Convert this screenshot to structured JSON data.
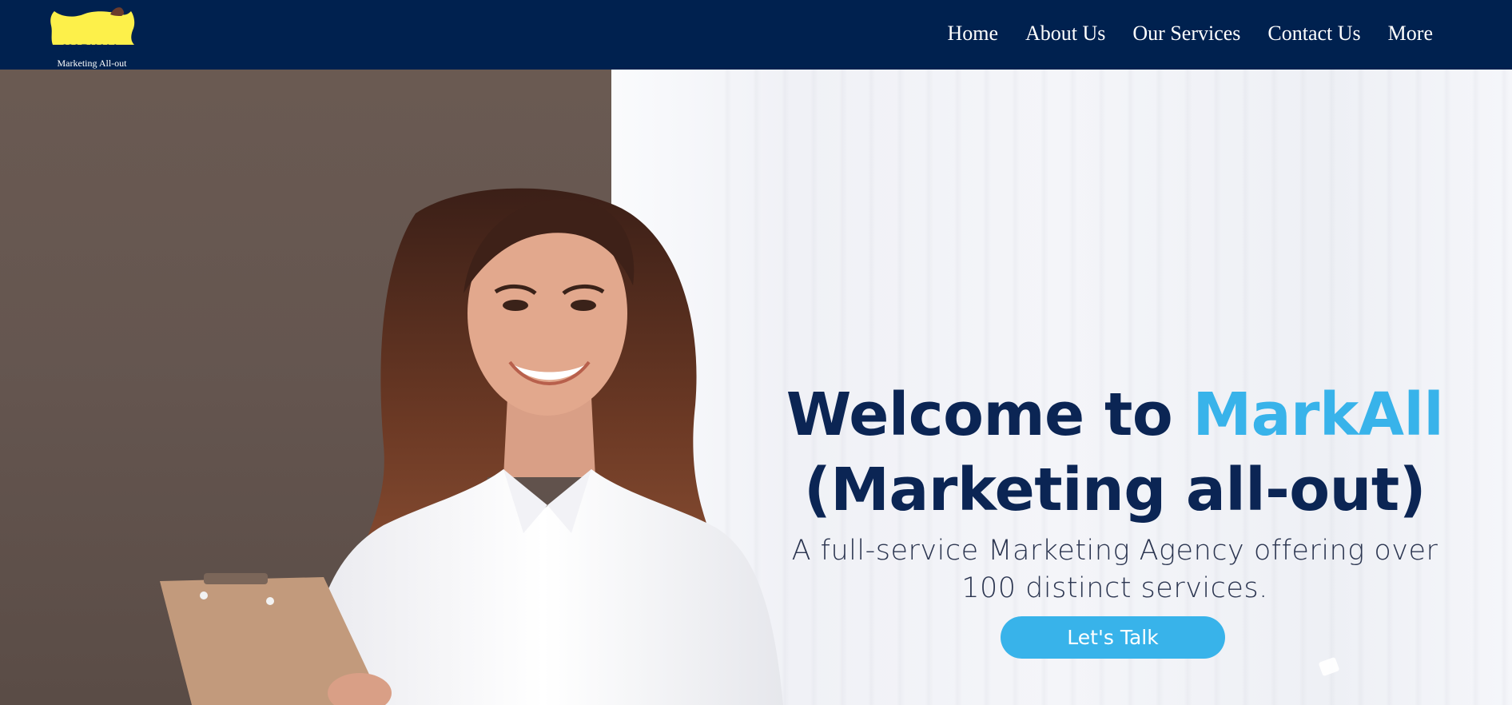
{
  "header": {
    "logo": {
      "name": "MARKALL",
      "tagline": "Marketing All-out",
      "brand_color": "#fdf04a",
      "background_color": "#00214f"
    },
    "nav": [
      {
        "label": "Home"
      },
      {
        "label": "About Us"
      },
      {
        "label": "Our Services"
      },
      {
        "label": "Contact Us"
      },
      {
        "label": "More"
      }
    ]
  },
  "hero": {
    "title_prefix": "Welcome to ",
    "title_accent": "MarkAll",
    "title_line2": "(Marketing all-out)",
    "subtitle": "A full-service Marketing Agency offering over 100 distinct services.",
    "cta_label": "Let's Talk",
    "accent_color": "#38b3ea",
    "title_color": "#0b2554"
  }
}
